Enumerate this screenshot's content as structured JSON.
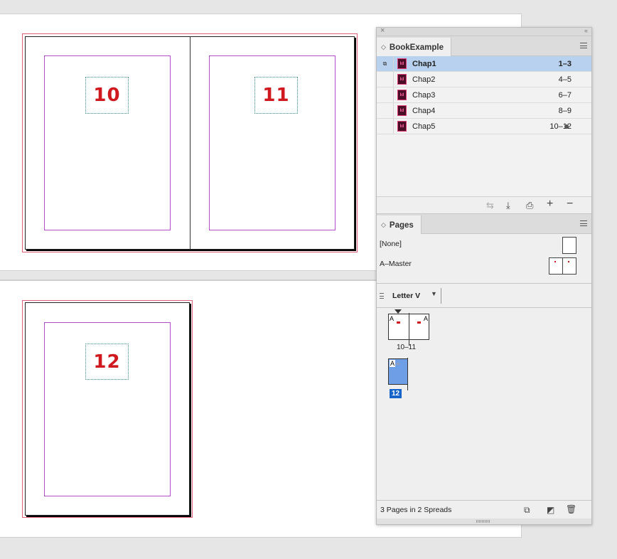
{
  "spreads": {
    "spread1": {
      "left_page_number": "10",
      "right_page_number": "11"
    },
    "spread2": {
      "page_number": "12"
    }
  },
  "book_panel": {
    "tab_title": "BookExample",
    "documents": [
      {
        "name": "Chap1",
        "pages": "1–3",
        "selected": true
      },
      {
        "name": "Chap2",
        "pages": "4–5"
      },
      {
        "name": "Chap3",
        "pages": "6–7"
      },
      {
        "name": "Chap4",
        "pages": "8–9"
      },
      {
        "name": "Chap5",
        "pages": "10–12",
        "open": true
      }
    ],
    "id_icon_text": "Id",
    "toolbar_icons": [
      "synchronize-icon",
      "save-book-icon",
      "print-book-icon",
      "add-document-icon",
      "remove-document-icon"
    ]
  },
  "pages_panel": {
    "tab_title": "Pages",
    "masters": {
      "none_label": "[None]",
      "a_master_label": "A–Master"
    },
    "page_size": "Letter V",
    "spreads": [
      {
        "label": "10–11",
        "master_left": "A",
        "master_right": "A"
      },
      {
        "label": "12",
        "master": "A",
        "selected": true
      }
    ],
    "status": "3 Pages in 2 Spreads"
  },
  "colors": {
    "page_number": "#d0191f",
    "margin_guide": "#b24cc9",
    "selection": "#1664c8",
    "row_selection": "#b8d1ef"
  }
}
